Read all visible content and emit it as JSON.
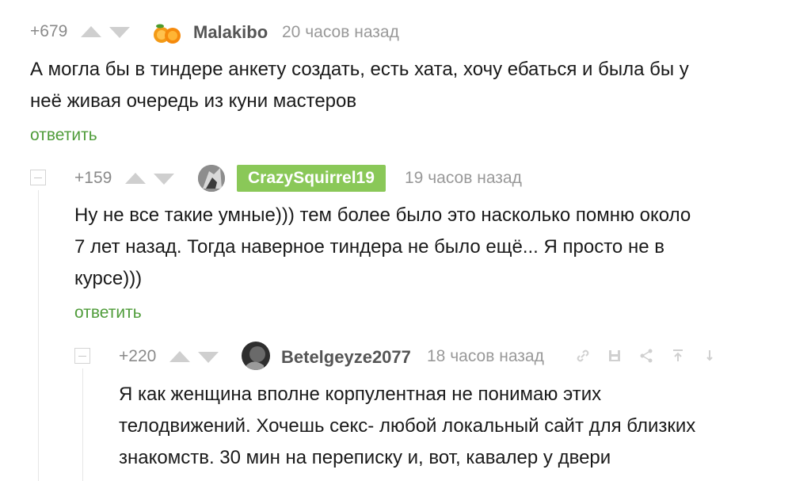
{
  "comments": [
    {
      "rating": "+679",
      "author": "Malakibo",
      "time": "20 часов назад",
      "text_lines": [
        "А могла бы в тиндере анкету создать, есть хата, хочу ебаться и была бы у",
        "неё живая очередь из куни мастеров"
      ],
      "reply": "ответить"
    },
    {
      "rating": "+159",
      "author": "CrazySquirrel19",
      "time": "19 часов назад",
      "text_lines": [
        "Ну не все такие умные))) тем более было это насколько помню около",
        "7 лет назад. Тогда наверное тиндера не было ещё... Я просто не в",
        "курсе)))"
      ],
      "reply": "ответить"
    },
    {
      "rating": "+220",
      "author": "Betelgeyze2077",
      "time": "18 часов назад",
      "text_lines": [
        "Я как женщина вполне корпулентная не понимаю этих",
        "телодвижений. Хочешь секс- любой локальный сайт для близких",
        "знакомств. 30 мин на переписку и, вот, кавалер у двери"
      ]
    }
  ],
  "colors": {
    "reply_green": "#4f9c3a",
    "author_badge_green": "#8ac858"
  },
  "icons": [
    "link-icon",
    "save-icon",
    "share-icon",
    "up-to-parent-icon",
    "down-icon"
  ]
}
